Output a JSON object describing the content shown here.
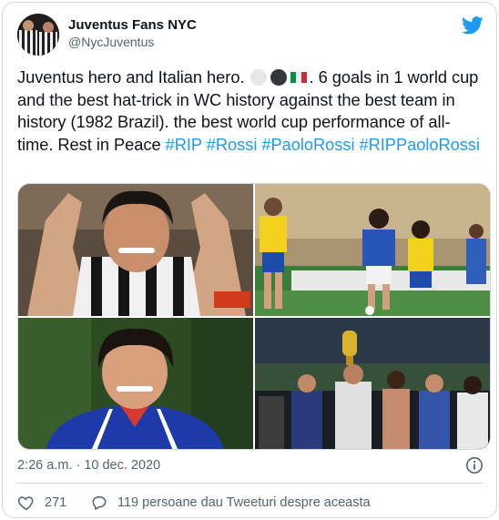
{
  "author": {
    "name": "Juventus Fans NYC",
    "handle": "@NycJuventus"
  },
  "tweet": {
    "text_before": "Juventus hero and Italian hero.",
    "text_after": ". 6 goals in 1 world cup and the best hat-trick in WC history against the best team in history (1982 Brazil). the best world cup performance of all-time. Rest in Peace",
    "hashtags": [
      "#RIP",
      "#Rossi",
      "#PaoloRossi",
      "#RIPPaoloRossi"
    ],
    "emojis": [
      "white-circle",
      "black-circle",
      "italy-flag"
    ]
  },
  "media": {
    "photos": [
      {
        "name": "player-arms-raised-photo"
      },
      {
        "name": "italy-vs-brazil-match-photo"
      },
      {
        "name": "player-portrait-photo"
      },
      {
        "name": "world-cup-trophy-celebration-photo"
      }
    ]
  },
  "meta": {
    "timestamp": "2:26 a.m. · 10 dec. 2020"
  },
  "actions": {
    "likes": "271",
    "reply_text": "119 persoane dau Tweeturi despre aceasta"
  },
  "colors": {
    "link": "#1d9bf0",
    "text": "#0f1419",
    "secondary": "#536471",
    "border": "#cfd9de",
    "italy_green": "#009246",
    "italy_red": "#ce2b37"
  },
  "icons": [
    "twitter-bird-icon",
    "info-icon",
    "heart-icon",
    "reply-bubble-icon"
  ]
}
